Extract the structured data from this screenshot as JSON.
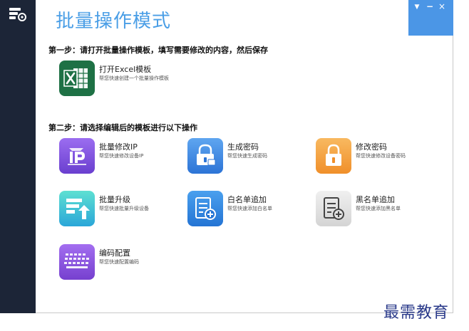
{
  "app": {
    "title": "批量操作模式"
  },
  "window_controls": {
    "menu": "▼",
    "minimize": "−",
    "close": "×"
  },
  "step1": {
    "heading": "第一步：请打开批量操作模板，填写需要修改的内容，然后保存",
    "items": [
      {
        "label": "打开Excel模板",
        "desc": "帮您快速创建一个批量操作模板",
        "color": "#1e7145"
      }
    ]
  },
  "step2": {
    "heading": "第二步：请选择编辑后的模板进行以下操作",
    "items": [
      {
        "label": "批量修改IP",
        "desc": "帮您快速修改设备IP",
        "color": "#7b4fd8"
      },
      {
        "label": "生成密码",
        "desc": "帮您快速生成密码",
        "color": "#3e8ee8"
      },
      {
        "label": "修改密码",
        "desc": "帮您快速修改设备密码",
        "color": "#f5a03a"
      },
      {
        "label": "批量升级",
        "desc": "帮您快速批量升级设备",
        "color": "#3cc7c9"
      },
      {
        "label": "白名单追加",
        "desc": "帮您快速添加白名单",
        "color": "#2f86e0"
      },
      {
        "label": "黑名单追加",
        "desc": "帮您快速添加黑名单",
        "color": "#dcdcdc"
      },
      {
        "label": "编码配置",
        "desc": "帮您快速配置编码",
        "color": "#8a4fd6"
      }
    ]
  },
  "watermark": "最需教育"
}
